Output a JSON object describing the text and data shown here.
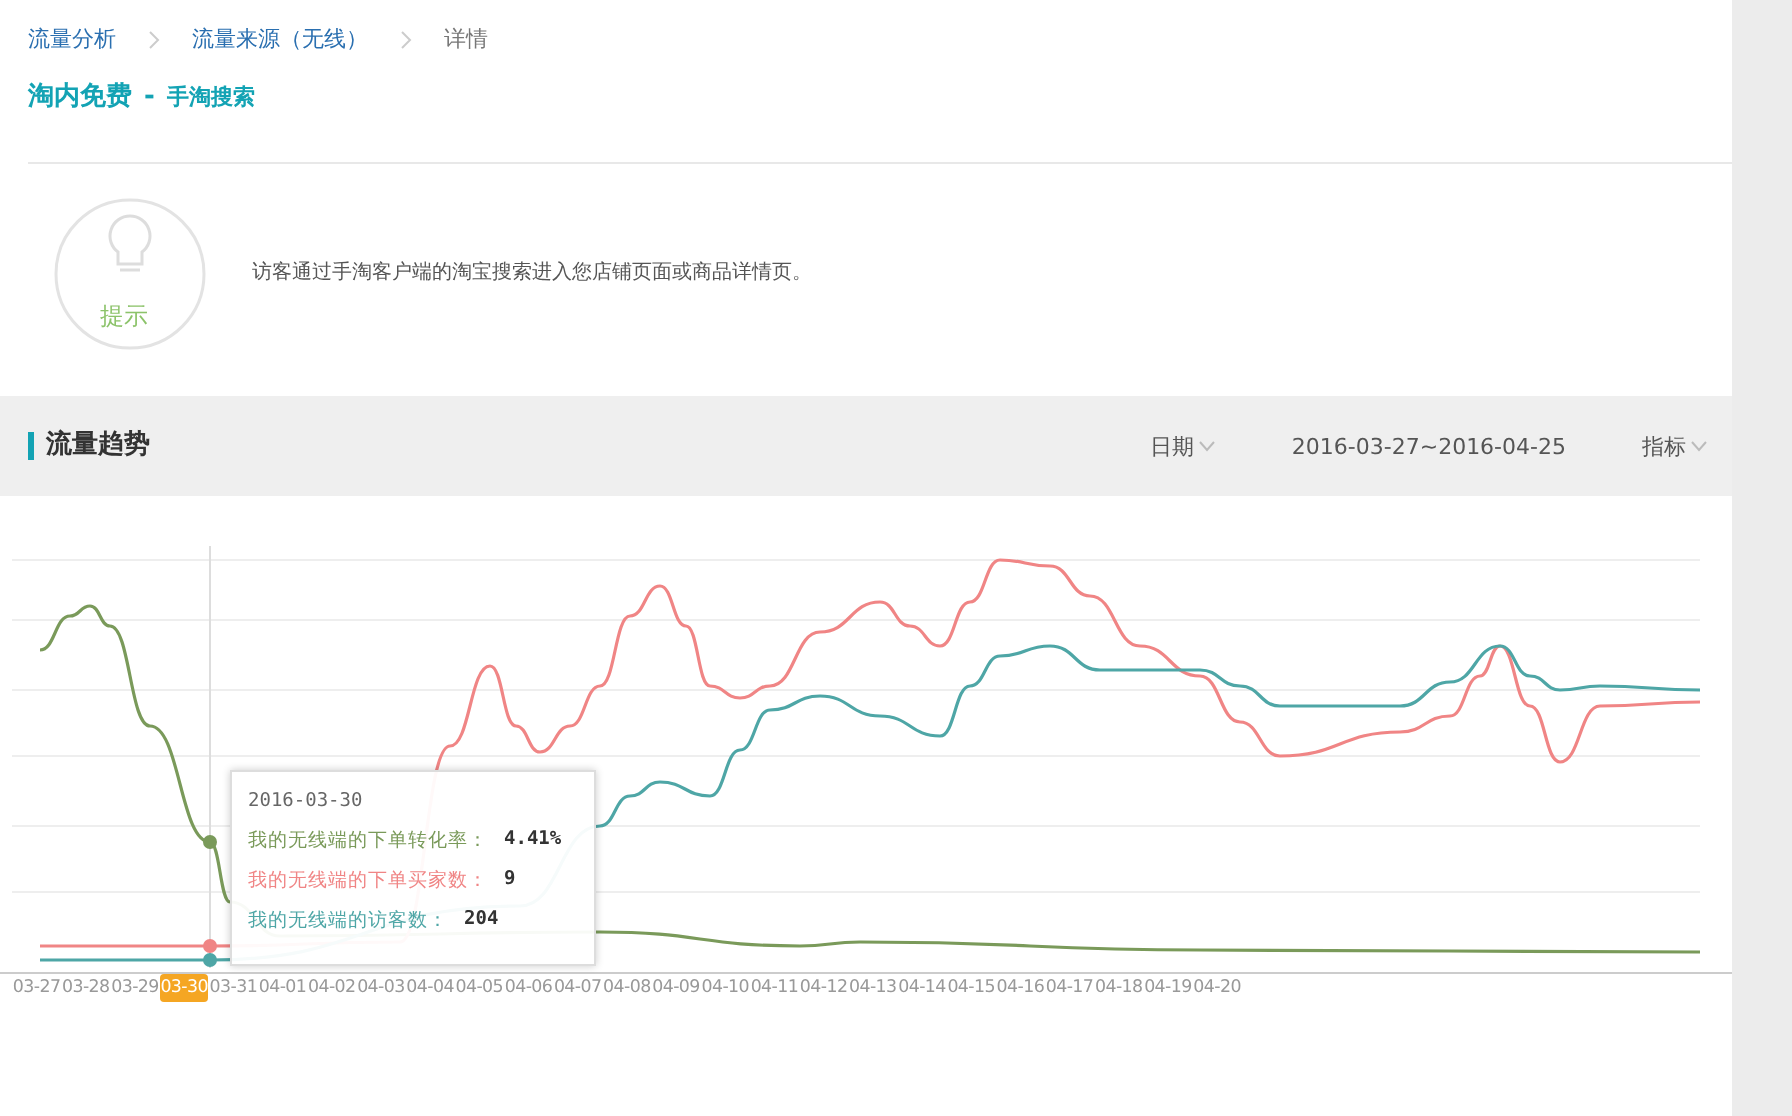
{
  "breadcrumb": [
    {
      "label": "流量分析",
      "link": true
    },
    {
      "label": "流量来源（无线）",
      "link": true
    },
    {
      "label": "详情",
      "link": false
    }
  ],
  "page_title": {
    "main": "淘内免费",
    "separator": "-",
    "sub": "手淘搜索"
  },
  "tip": {
    "label": "提示",
    "text": "访客通过手淘客户端的淘宝搜索进入您店铺页面或商品详情页。"
  },
  "trend": {
    "title": "流量趋势",
    "date_dropdown": "日期",
    "date_range": "2016-03-27~2016-04-25",
    "metric_dropdown": "指标",
    "tooltip": {
      "date": "2016-03-30",
      "rows": [
        {
          "label": "我的无线端的下单转化率：",
          "value": "4.41%",
          "color": "#7a9a5a"
        },
        {
          "label": "我的无线端的下单买家数：",
          "value": "9",
          "color": "#f08585"
        },
        {
          "label": "我的无线端的访客数：",
          "value": "204",
          "color": "#4ea6a6"
        }
      ]
    },
    "x_labels": [
      {
        "label": "03-27",
        "selected": false
      },
      {
        "label": "03-28",
        "selected": false
      },
      {
        "label": "03-29",
        "selected": false
      },
      {
        "label": "03-30",
        "selected": true
      },
      {
        "label": "03-31",
        "selected": false
      },
      {
        "label": "04-01",
        "selected": false
      },
      {
        "label": "04-02",
        "selected": false
      },
      {
        "label": "04-03",
        "selected": false
      },
      {
        "label": "04-04",
        "selected": false
      },
      {
        "label": "04-05",
        "selected": false
      },
      {
        "label": "04-06",
        "selected": false
      },
      {
        "label": "04-07",
        "selected": false
      },
      {
        "label": "04-08",
        "selected": false
      },
      {
        "label": "04-09",
        "selected": false
      },
      {
        "label": "04-10",
        "selected": false
      },
      {
        "label": "04-11",
        "selected": false
      },
      {
        "label": "04-12",
        "selected": false
      },
      {
        "label": "04-13",
        "selected": false
      },
      {
        "label": "04-14",
        "selected": false
      },
      {
        "label": "04-15",
        "selected": false
      },
      {
        "label": "04-16",
        "selected": false
      },
      {
        "label": "04-17",
        "selected": false
      },
      {
        "label": "04-18",
        "selected": false
      },
      {
        "label": "04-19",
        "selected": false
      },
      {
        "label": "04-20",
        "selected": false
      }
    ]
  }
}
